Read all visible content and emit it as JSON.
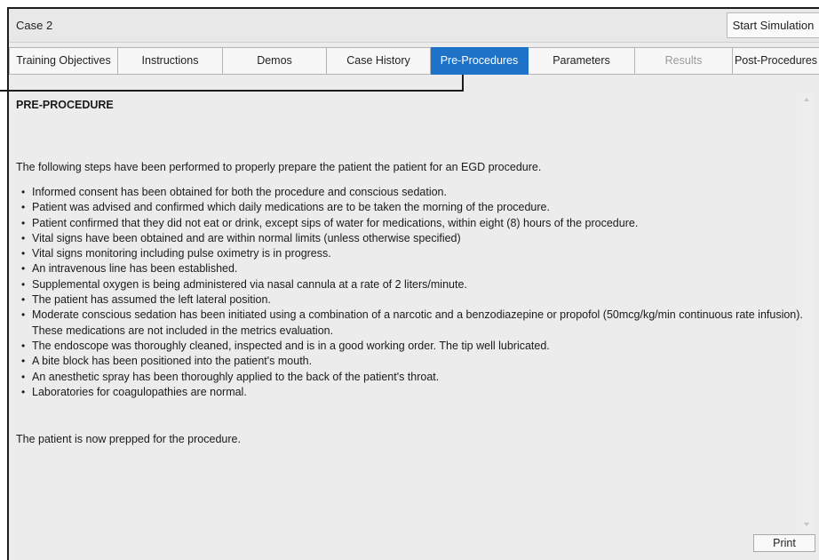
{
  "window": {
    "case_title": "Case 2",
    "start_simulation_label": "Start Simulation"
  },
  "tabs": [
    {
      "label": "Training Objectives",
      "state": "normal"
    },
    {
      "label": "Instructions",
      "state": "normal"
    },
    {
      "label": "Demos",
      "state": "normal"
    },
    {
      "label": "Case History",
      "state": "normal"
    },
    {
      "label": "Pre-Procedures",
      "state": "active"
    },
    {
      "label": "Parameters",
      "state": "normal"
    },
    {
      "label": "Results",
      "state": "disabled"
    },
    {
      "label": "Post-Procedures",
      "state": "normal"
    }
  ],
  "content": {
    "heading": "PRE-PROCEDURE",
    "intro": "The following steps have been performed to properly prepare the patient the patient for an EGD procedure.",
    "steps": [
      "Informed consent has been obtained for both the procedure and conscious sedation.",
      "Patient was advised and confirmed which daily medications are to be taken the morning of the procedure.",
      "Patient confirmed that they did not eat or drink, except sips of water for medications, within eight (8) hours of the procedure.",
      "Vital signs have been obtained and are within normal limits (unless otherwise specified)",
      "Vital signs monitoring including pulse oximetry is in progress.",
      "An intravenous line has been established.",
      "Supplemental oxygen is being administered via nasal cannula at a rate of 2 liters/minute.",
      "The patient has assumed the left lateral position.",
      "Moderate conscious sedation has been initiated using a combination of a narcotic and a benzodiazepine or propofol (50mcg/kg/min continuous rate infusion). These medications are not included in the metrics evaluation.",
      "The endoscope was thoroughly cleaned, inspected and is in a good working order. The tip well lubricated.",
      "A bite block has been positioned into the patient's mouth.",
      "An anesthetic spray has been thoroughly applied to the back of the patient's throat.",
      "Laboratories for coagulopathies are normal."
    ],
    "outro": "The patient is now prepped for the procedure."
  },
  "footer": {
    "print_label": "Print"
  },
  "colors": {
    "active_tab": "#1e72c8",
    "window_bg": "#ececec",
    "disabled_text": "#9a9a9a"
  },
  "icons": {
    "scroll_up": "scroll-up-arrow-icon",
    "scroll_down": "scroll-down-arrow-icon"
  }
}
